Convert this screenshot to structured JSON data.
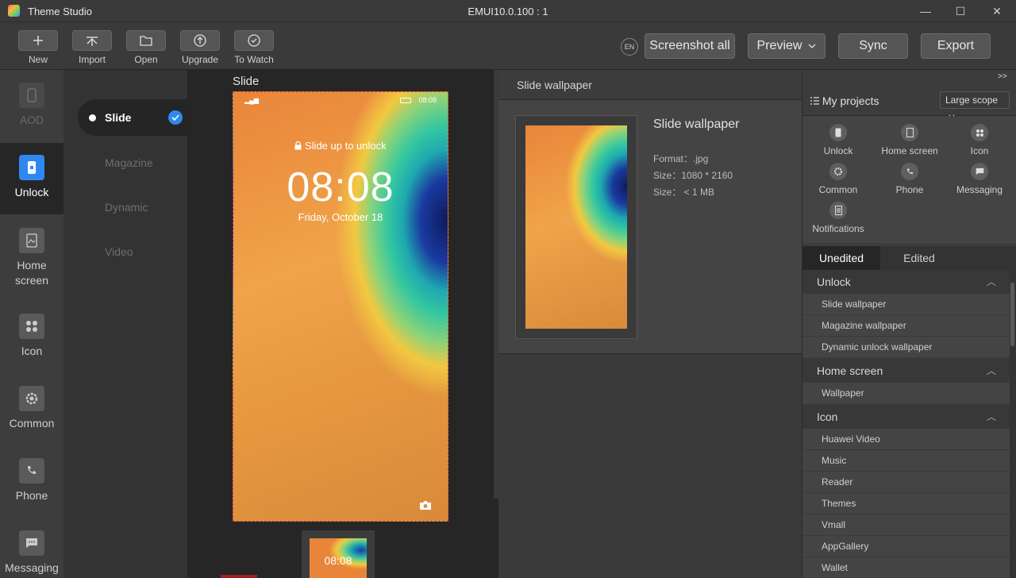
{
  "app": {
    "title": "Theme Studio",
    "version": "EMUI10.0.100 : 1"
  },
  "window": {
    "minimize": "—",
    "maximize": "☐",
    "close": "✕"
  },
  "toolbar": {
    "new": "New",
    "import": "Import",
    "open": "Open",
    "upgrade": "Upgrade",
    "to_watch": "To Watch",
    "lang": "EN",
    "screenshot_all": "Screenshot all",
    "preview": "Preview",
    "sync": "Sync",
    "export": "Export"
  },
  "rail": {
    "aod": "AOD",
    "unlock": "Unlock",
    "home_screen": "Home screen",
    "icon": "Icon",
    "common": "Common",
    "phone": "Phone",
    "messaging": "Messaging"
  },
  "submenu": {
    "slide": "Slide",
    "magazine": "Magazine",
    "dynamic": "Dynamic",
    "video": "Video"
  },
  "canvas": {
    "title": "Slide",
    "status_time": "08:08",
    "slide_text": "Slide up to unlock",
    "clock": "08:08",
    "date": "Friday, October 18",
    "thumb_clock": "08:08"
  },
  "detail": {
    "header": "Slide wallpaper",
    "title": "Slide wallpaper",
    "format": "Format：.jpg",
    "size": "Size：1080 * 2160",
    "size_limit": "Size： < 1 MB"
  },
  "projects": {
    "title": "My projects",
    "expand": ">>",
    "scope": "Large scope",
    "items": {
      "unlock": "Unlock",
      "home_screen": "Home screen",
      "icon": "Icon",
      "common": "Common",
      "phone": "Phone",
      "messaging": "Messaging",
      "notifications": "Notifications"
    }
  },
  "tabs": {
    "unedited": "Unedited",
    "edited": "Edited"
  },
  "tree": {
    "unlock": {
      "label": "Unlock",
      "items": [
        "Slide wallpaper",
        "Magazine wallpaper",
        "Dynamic unlock wallpaper"
      ]
    },
    "home": {
      "label": "Home screen",
      "items": [
        "Wallpaper"
      ]
    },
    "icon": {
      "label": "Icon",
      "items": [
        "Huawei Video",
        "Music",
        "Reader",
        "Themes",
        "Vmall",
        "AppGallery",
        "Wallet"
      ]
    }
  }
}
